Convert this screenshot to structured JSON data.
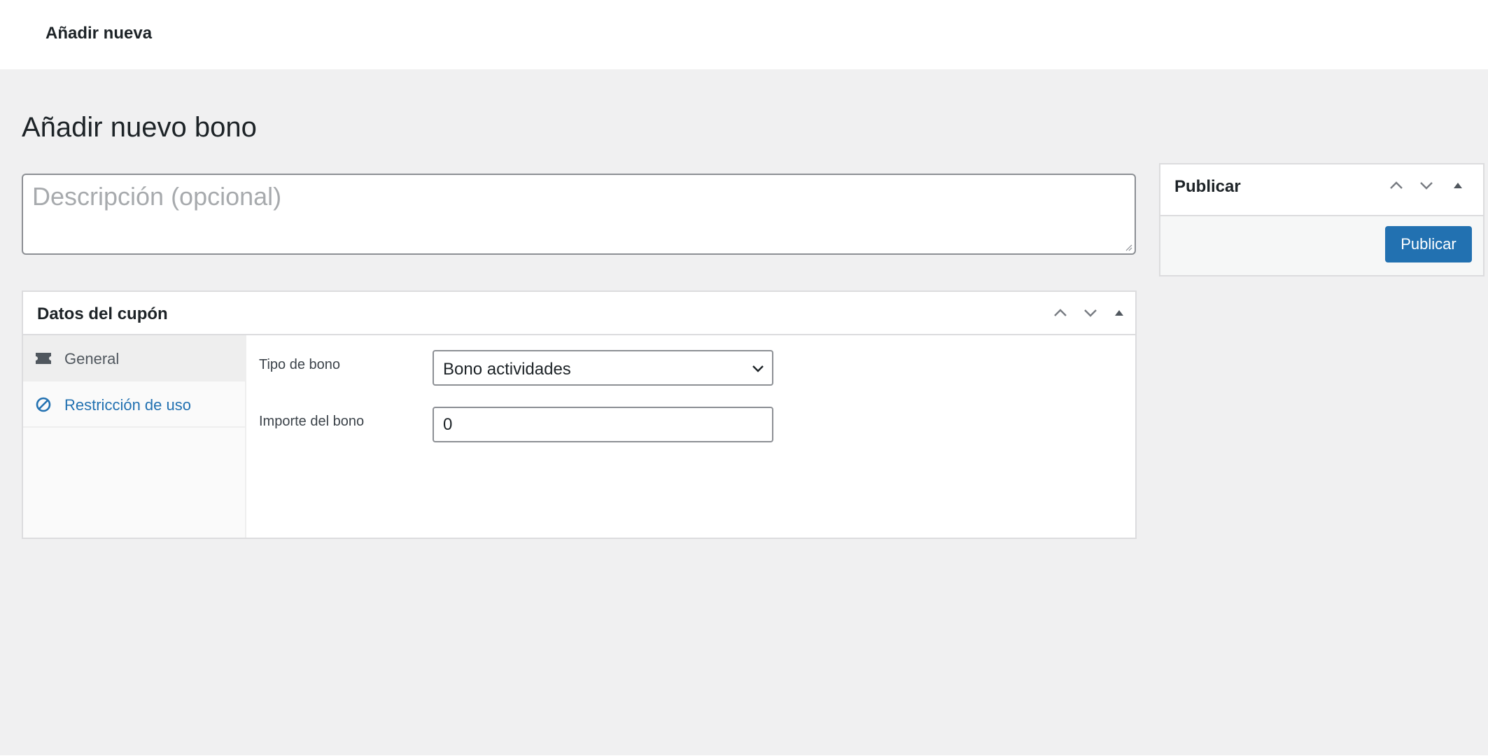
{
  "topbar": {
    "title": "Añadir nueva"
  },
  "page": {
    "title": "Añadir nuevo bono"
  },
  "description": {
    "value": "",
    "placeholder": "Descripción (opcional)"
  },
  "coupon_box": {
    "title": "Datos del cupón",
    "tabs": [
      {
        "label": "General",
        "icon": "ticket-icon",
        "active": true
      },
      {
        "label": "Restricción de uso",
        "icon": "block-icon",
        "active": false
      }
    ],
    "fields": {
      "type_label": "Tipo de bono",
      "type_value": "Bono actividades",
      "amount_label": "Importe del bono",
      "amount_value": "0"
    }
  },
  "publish_box": {
    "title": "Publicar",
    "button_label": "Publicar"
  },
  "colors": {
    "accent": "#2271b1",
    "background": "#f0f0f1",
    "panel": "#ffffff",
    "border": "#dcdcde"
  }
}
